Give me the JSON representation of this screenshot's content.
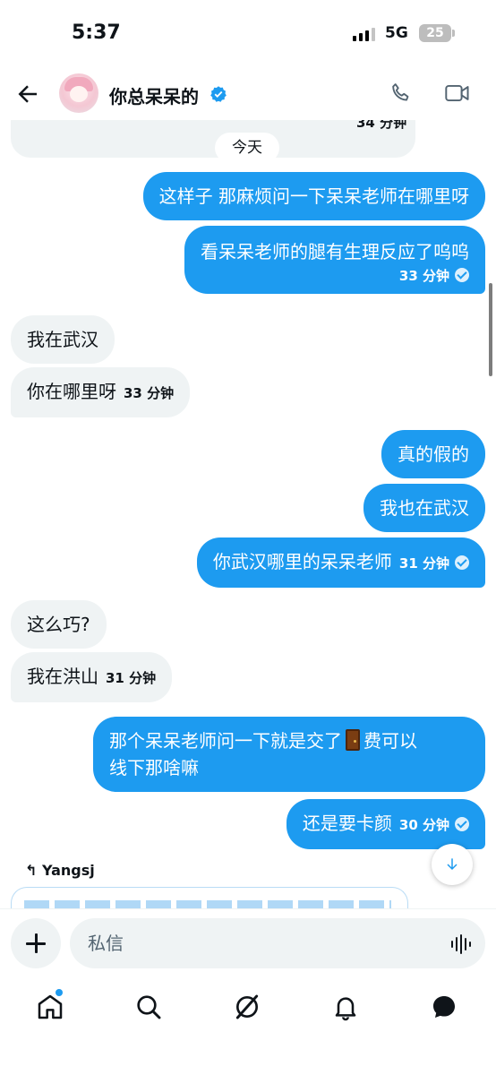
{
  "status_bar": {
    "time": "5:37",
    "network": "5G",
    "battery": "25"
  },
  "header": {
    "contact_name": "你总呆呆的"
  },
  "chat": {
    "previous_message_time": "34 分钟",
    "date_divider": "今天",
    "messages": [
      {
        "direction": "outgoing",
        "text": "这样子 那麻烦问一下呆呆老师在哪里呀"
      },
      {
        "direction": "outgoing",
        "text": "看呆呆老师的腿有生理反应了呜呜",
        "time": "33 分钟"
      },
      {
        "direction": "incoming",
        "text": "我在武汉"
      },
      {
        "direction": "incoming",
        "text": "你在哪里呀",
        "time": "33 分钟"
      },
      {
        "direction": "outgoing",
        "text": "真的假的"
      },
      {
        "direction": "outgoing",
        "text": "我也在武汉"
      },
      {
        "direction": "outgoing",
        "text": "你武汉哪里的呆呆老师",
        "time": "31 分钟"
      },
      {
        "direction": "incoming",
        "text": "这么巧?"
      },
      {
        "direction": "incoming",
        "text": "我在洪山",
        "time": "31 分钟"
      },
      {
        "direction": "outgoing",
        "text_line1_before_emoji": "那个呆呆老师问一下就是交了",
        "text_line1_after_emoji": "费可以",
        "text_line2": "线下那啥嘛",
        "emoji": "door"
      },
      {
        "direction": "outgoing",
        "text": "还是要卡颜",
        "time": "30 分钟"
      }
    ],
    "reply_to": "Yangsj"
  },
  "composer": {
    "placeholder": "私信"
  },
  "nav": [
    "home-icon",
    "search-icon",
    "grok-icon",
    "notifications-icon",
    "messages-icon"
  ],
  "colors": {
    "accent": "#1d9bf0",
    "incoming_bubble": "#eff3f4",
    "text": "#0f1419"
  }
}
